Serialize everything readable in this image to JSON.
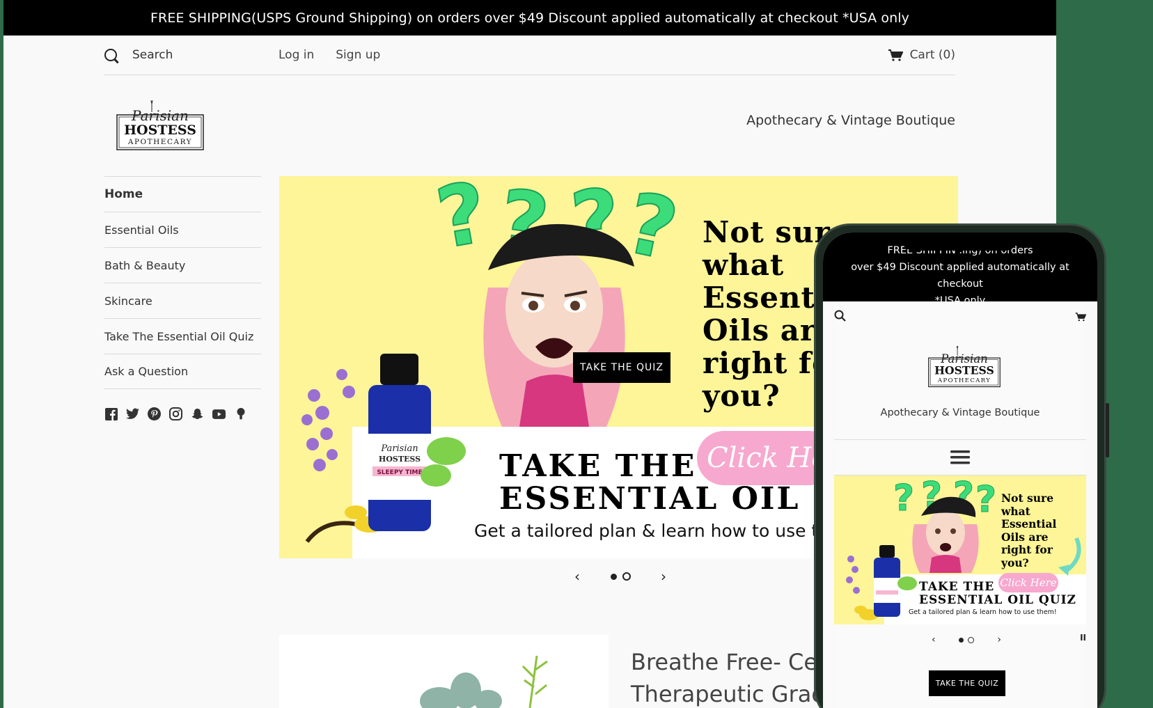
{
  "announcement": "FREE SHIPPING(USPS Ground Shipping) on orders over $49 Discount applied automatically at checkout *USA only",
  "header": {
    "search_placeholder": "Search",
    "login": "Log in",
    "signup": "Sign up",
    "cart": "Cart (0)",
    "tagline": "Apothecary & Vintage Boutique"
  },
  "logo": {
    "line1": "Parisian",
    "line2": "HOSTESS",
    "line3": "APOTHECARY"
  },
  "nav": {
    "items": [
      {
        "label": "Home"
      },
      {
        "label": "Essential Oils"
      },
      {
        "label": "Bath & Beauty"
      },
      {
        "label": "Skincare"
      },
      {
        "label": "Take The Essential Oil Quiz"
      },
      {
        "label": "Ask a Question"
      }
    ]
  },
  "social": [
    "facebook-icon",
    "twitter-icon",
    "pinterest-icon",
    "instagram-icon",
    "snapchat-icon",
    "youtube-icon",
    "podcast-icon"
  ],
  "hero": {
    "question": "Not sure what Essenti Oils are right fo you?",
    "question_lines": [
      "Not sure",
      "what",
      "Essenti",
      "Oils are",
      "right fo",
      "you?"
    ],
    "quiz_heading_1": "TAKE THE",
    "quiz_heading_2": "ESSENTIAL OIL QU",
    "subtitle": "Get a tailored plan & learn how to use ther",
    "click_here": "Click He",
    "bottle_label": "SLEEPY TIME",
    "take_quiz_button": "TAKE THE QUIZ"
  },
  "feature": {
    "title_line1": "Breathe Free- Certif",
    "title_line2": "Therapeutic Grade"
  },
  "phone": {
    "announce_line1": "FREE SHIPPIN          .ing) on orders",
    "announce_line2": "over $49 Discount applied automatically at checkout",
    "announce_line3": "*USA only",
    "tagline": "Apothecary & Vintage Boutique",
    "hero_question": [
      "Not sure",
      "what",
      "Essential",
      "Oils are",
      "right for",
      "you?"
    ],
    "hero_quiz_1": "TAKE THE",
    "hero_quiz_2": "ESSENTIAL OIL QUIZ",
    "hero_sub": "Get a tailored plan & learn how to use them!",
    "hero_click": "Click Here",
    "pause": "II",
    "take_quiz_button": "TAKE THE QUIZ"
  },
  "colors": {
    "hero_bg": "#fdf597",
    "accent_green": "#3ddc7b",
    "pink": "#f7a8cf",
    "page_bg": "#2e6b48"
  }
}
